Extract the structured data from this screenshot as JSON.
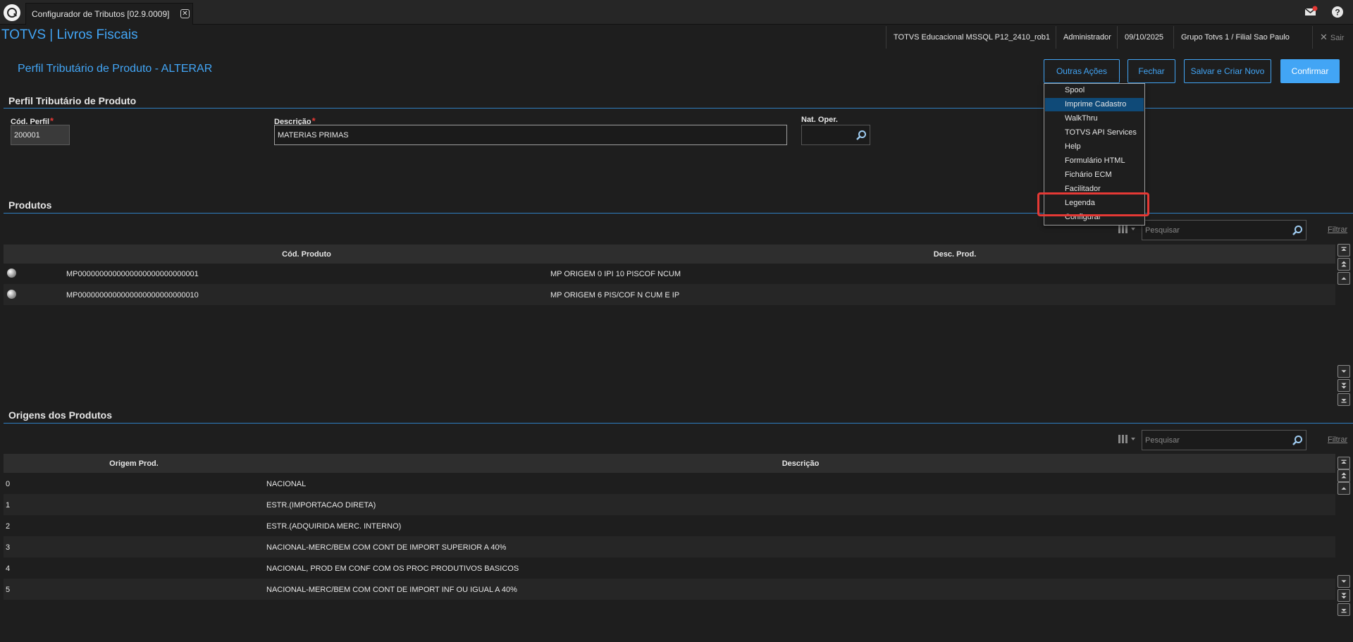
{
  "tab": {
    "title": "Configurador de Tributos [02.9.0009]"
  },
  "brand": "TOTVS | Livros Fiscais",
  "header_info": {
    "environment": "TOTVS Educacional MSSQL P12_2410_rob1",
    "user": "Administrador",
    "date": "09/10/2025",
    "company": "Grupo Totvs 1 / Filial Sao Paulo",
    "logout": "Sair"
  },
  "page_title": "Perfil Tributário de Produto - ALTERAR",
  "actions": {
    "outras_acoes": "Outras Ações",
    "fechar": "Fechar",
    "salvar_criar": "Salvar e Criar Novo",
    "confirmar": "Confirmar"
  },
  "outras_menu": [
    "Spool",
    "Imprime Cadastro",
    "WalkThru",
    "TOTVS API Services",
    "Help",
    "Formulário HTML",
    "Fichário ECM",
    "Facilitador",
    "Legenda",
    "Configurar"
  ],
  "section_perfil": "Perfil Tributário de Produto",
  "form": {
    "cod_perfil_label": "Cód. Perfil",
    "cod_perfil_value": "200001",
    "descricao_label": "Descrição",
    "descricao_value": "MATERIAS PRIMAS",
    "nat_oper_label": "Nat. Oper.",
    "nat_oper_value": ""
  },
  "section_produtos": "Produtos",
  "search_placeholder": "Pesquisar",
  "filter_label": "Filtrar",
  "produtos": {
    "headers": [
      "Cód. Produto",
      "Desc. Prod."
    ],
    "rows": [
      {
        "cod": "MP0000000000000000000000000001",
        "desc": "MP ORIGEM 0 IPI 10 PISCOF NCUM"
      },
      {
        "cod": "MP0000000000000000000000000010",
        "desc": "MP ORIGEM 6 PIS/COF N CUM E IP"
      }
    ]
  },
  "section_origens": "Origens dos Produtos",
  "origens": {
    "headers": [
      "Origem Prod.",
      "Descrição"
    ],
    "rows": [
      {
        "code": "0",
        "desc": "NACIONAL"
      },
      {
        "code": "1",
        "desc": "ESTR.(IMPORTACAO DIRETA)"
      },
      {
        "code": "2",
        "desc": "ESTR.(ADQUIRIDA MERC. INTERNO)"
      },
      {
        "code": "3",
        "desc": "NACIONAL-MERC/BEM COM CONT DE IMPORT SUPERIOR A 40%"
      },
      {
        "code": "4",
        "desc": "NACIONAL, PROD EM CONF COM OS PROC PRODUTIVOS BASICOS"
      },
      {
        "code": "5",
        "desc": "NACIONAL-MERC/BEM COM CONT DE IMPORT INF OU IGUAL A 40%"
      }
    ]
  },
  "colors": {
    "accent": "#42a5f5",
    "background": "#1e1e1e",
    "highlight": "#e53935",
    "selected": "#0f4a78"
  }
}
